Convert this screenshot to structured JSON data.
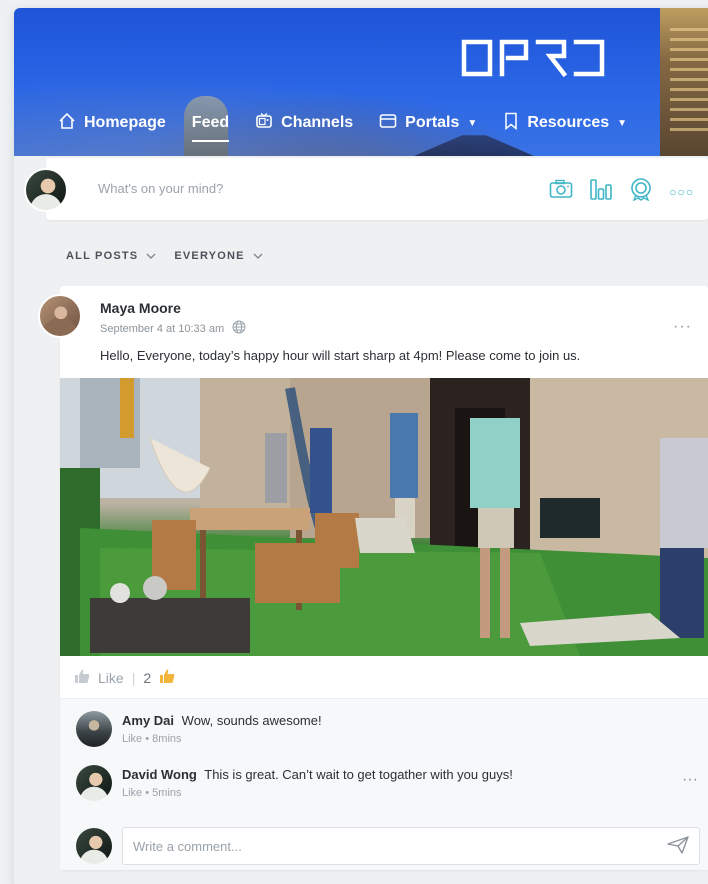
{
  "brand": {
    "logo_text": "OPRO",
    "accent": "#2a66e6"
  },
  "nav": {
    "items": [
      {
        "label": "Homepage",
        "icon": "home-icon",
        "active": false
      },
      {
        "label": "Feed",
        "icon": "",
        "active": true
      },
      {
        "label": "Channels",
        "icon": "tv-icon",
        "active": false
      },
      {
        "label": "Portals",
        "icon": "portal-window-icon",
        "active": false,
        "dropdown": true
      },
      {
        "label": "Resources",
        "icon": "bookmark-icon",
        "active": false,
        "dropdown": true
      }
    ]
  },
  "composer": {
    "placeholder": "What's on your mind?",
    "tools": [
      "camera-icon",
      "poll-chart-icon",
      "badge-icon",
      "more-icon"
    ],
    "tool_color": "#3fb6c6"
  },
  "filters": [
    {
      "label": "ALL POSTS"
    },
    {
      "label": "EVERYONE"
    }
  ],
  "post": {
    "author": "Maya Moore",
    "time": "September 4 at 10:33 am",
    "text": "Hello, Everyone, today’s happy hour will start sharp at 4pm! Please come to join us.",
    "like_label": "Like",
    "like_count": "2"
  },
  "comments": [
    {
      "name": "Amy Dai",
      "text": "Wow, sounds awesome!",
      "like": "Like",
      "time": "8mins"
    },
    {
      "name": "David Wong",
      "text": "This is great. Can’t wait to get togather with you guys!",
      "like": "Like",
      "time": "5mins"
    }
  ],
  "comment_input": {
    "placeholder": "Write a comment..."
  }
}
